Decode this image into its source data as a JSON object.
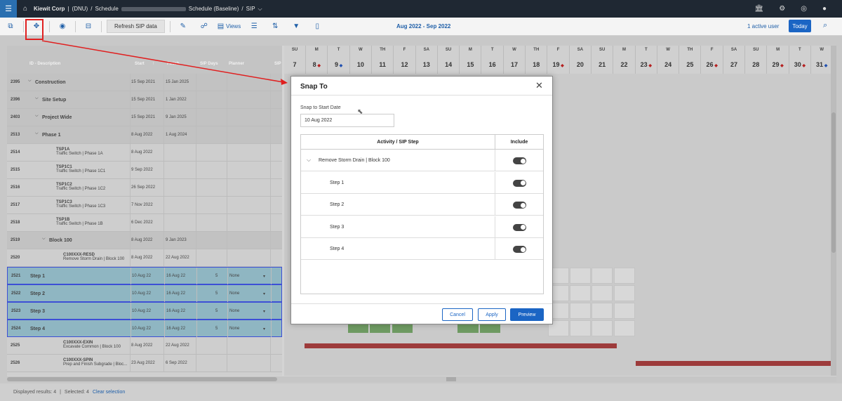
{
  "topbar": {
    "company": "Kiewit Corp",
    "sep1": "|",
    "project": "(DNU)",
    "slash1": "/",
    "schedule": "Schedule",
    "schedule_name": "Schedule (Baseline)",
    "slash2": "/",
    "current": "SIP",
    "current_chevron": "⌵"
  },
  "toolbar": {
    "refresh_label": "Refresh SIP data",
    "views_label": "Views",
    "date_range": "Aug 2022 - Sep 2022",
    "active_users": "1 active user",
    "today_label": "Today"
  },
  "grid": {
    "headers": {
      "id_desc": "ID - Description",
      "start": "Start",
      "start_sort": "↑",
      "finish": "Finish",
      "sip_days": "SIP Days",
      "planner": "Planner",
      "sip": "SIP"
    },
    "rows": [
      {
        "id": "2395",
        "desc": "Construction",
        "sub": "",
        "start": "15 Sep 2021",
        "finish": "15 Jan 2025",
        "days": "",
        "planner": ""
      },
      {
        "id": "2396",
        "desc": "Site Setup",
        "sub": "",
        "start": "15 Sep 2021",
        "finish": "1 Jan 2022",
        "days": "",
        "planner": ""
      },
      {
        "id": "2403",
        "desc": "Project Wide",
        "sub": "",
        "start": "15 Sep 2021",
        "finish": "9 Jan 2025",
        "days": "",
        "planner": ""
      },
      {
        "id": "2513",
        "desc": "Phase 1",
        "sub": "",
        "start": "8 Aug 2022",
        "finish": "1 Aug 2024",
        "days": "",
        "planner": ""
      },
      {
        "id": "2514",
        "desc": "TSP1A",
        "sub": "Traffic Switch | Phase 1A",
        "start": "8 Aug 2022",
        "finish": "",
        "days": "",
        "planner": ""
      },
      {
        "id": "2515",
        "desc": "TSP1C1",
        "sub": "Traffic Switch | Phase 1C1",
        "start": "9 Sep 2022",
        "finish": "",
        "days": "",
        "planner": ""
      },
      {
        "id": "2516",
        "desc": "TSP1C2",
        "sub": "Traffic Switch | Phase 1C2",
        "start": "26 Sep 2022",
        "finish": "",
        "days": "",
        "planner": ""
      },
      {
        "id": "2517",
        "desc": "TSP1C3",
        "sub": "Traffic Switch | Phase 1C3",
        "start": "7 Nov 2022",
        "finish": "",
        "days": "",
        "planner": ""
      },
      {
        "id": "2518",
        "desc": "TSP1B",
        "sub": "Traffic Switch | Phase 1B",
        "start": "6 Dec 2022",
        "finish": "",
        "days": "",
        "planner": ""
      },
      {
        "id": "2519",
        "desc": "Block 100",
        "sub": "",
        "start": "8 Aug 2022",
        "finish": "9 Jan 2023",
        "days": "",
        "planner": ""
      },
      {
        "id": "2520",
        "desc": "C100XXX-RESD",
        "sub": "Remove Storm Drain | Block 100",
        "start": "8 Aug 2022",
        "finish": "22 Aug 2022",
        "days": "",
        "planner": ""
      },
      {
        "id": "2521",
        "desc": "Step 1",
        "sub": "",
        "start": "10 Aug 22",
        "finish": "16 Aug 22",
        "days": "5",
        "planner": "None"
      },
      {
        "id": "2522",
        "desc": "Step 2",
        "sub": "",
        "start": "10 Aug 22",
        "finish": "16 Aug 22",
        "days": "5",
        "planner": "None"
      },
      {
        "id": "2523",
        "desc": "Step 3",
        "sub": "",
        "start": "10 Aug 22",
        "finish": "16 Aug 22",
        "days": "5",
        "planner": "None"
      },
      {
        "id": "2524",
        "desc": "Step 4",
        "sub": "",
        "start": "10 Aug 22",
        "finish": "16 Aug 22",
        "days": "5",
        "planner": "None"
      },
      {
        "id": "2525",
        "desc": "C100XXX-EXIN",
        "sub": "Excavate Common | Block 100",
        "start": "8 Aug 2022",
        "finish": "22 Aug 2022",
        "days": "",
        "planner": ""
      },
      {
        "id": "2526",
        "desc": "C100XXX-SPIN",
        "sub": "Prep and Finish Subgrade | Bloc...",
        "start": "23 Aug 2022",
        "finish": "6 Sep 2022",
        "days": "",
        "planner": ""
      }
    ]
  },
  "calendar": {
    "days": [
      {
        "dow": "SU",
        "num": "7",
        "mark": ""
      },
      {
        "dow": "M",
        "num": "8",
        "mark": "red"
      },
      {
        "dow": "T",
        "num": "9",
        "mark": "blue"
      },
      {
        "dow": "W",
        "num": "10",
        "mark": ""
      },
      {
        "dow": "TH",
        "num": "11",
        "mark": ""
      },
      {
        "dow": "F",
        "num": "12",
        "mark": ""
      },
      {
        "dow": "SA",
        "num": "13",
        "mark": ""
      },
      {
        "dow": "SU",
        "num": "14",
        "mark": ""
      },
      {
        "dow": "M",
        "num": "15",
        "mark": ""
      },
      {
        "dow": "T",
        "num": "16",
        "mark": ""
      },
      {
        "dow": "W",
        "num": "17",
        "mark": ""
      },
      {
        "dow": "TH",
        "num": "18",
        "mark": ""
      },
      {
        "dow": "F",
        "num": "19",
        "mark": "red"
      },
      {
        "dow": "SA",
        "num": "20",
        "mark": ""
      },
      {
        "dow": "SU",
        "num": "21",
        "mark": ""
      },
      {
        "dow": "M",
        "num": "22",
        "mark": ""
      },
      {
        "dow": "T",
        "num": "23",
        "mark": "red"
      },
      {
        "dow": "W",
        "num": "24",
        "mark": ""
      },
      {
        "dow": "TH",
        "num": "25",
        "mark": ""
      },
      {
        "dow": "F",
        "num": "26",
        "mark": "red"
      },
      {
        "dow": "SA",
        "num": "27",
        "mark": ""
      },
      {
        "dow": "SU",
        "num": "28",
        "mark": ""
      },
      {
        "dow": "M",
        "num": "29",
        "mark": "red"
      },
      {
        "dow": "T",
        "num": "30",
        "mark": "red"
      },
      {
        "dow": "W",
        "num": "31",
        "mark": "blue"
      }
    ]
  },
  "footer": {
    "displayed": "Displayed results: 4",
    "sep": "|",
    "selected": "Selected: 4",
    "clear": "Clear selection"
  },
  "modal": {
    "title": "Snap To",
    "close": "✕",
    "field_label": "Snap to Start Date",
    "field_value": "10 Aug 2022",
    "col_activity": "Activity / SIP Step",
    "col_include": "Include",
    "rows": [
      {
        "label": "Remove Storm Drain | Block 100",
        "parent": true
      },
      {
        "label": "Step 1",
        "parent": false
      },
      {
        "label": "Step 2",
        "parent": false
      },
      {
        "label": "Step 3",
        "parent": false
      },
      {
        "label": "Step 4",
        "parent": false
      }
    ],
    "cancel_label": "Cancel",
    "apply_label": "Apply",
    "preview_label": "Preview"
  },
  "colors": {
    "accent": "#1b65c4",
    "topbar": "#1f2833",
    "selected_row": "#8fb6c2",
    "bar_red": "#9d3b3b",
    "bar_green": "#6e9a62",
    "highlight": "#e02020"
  }
}
